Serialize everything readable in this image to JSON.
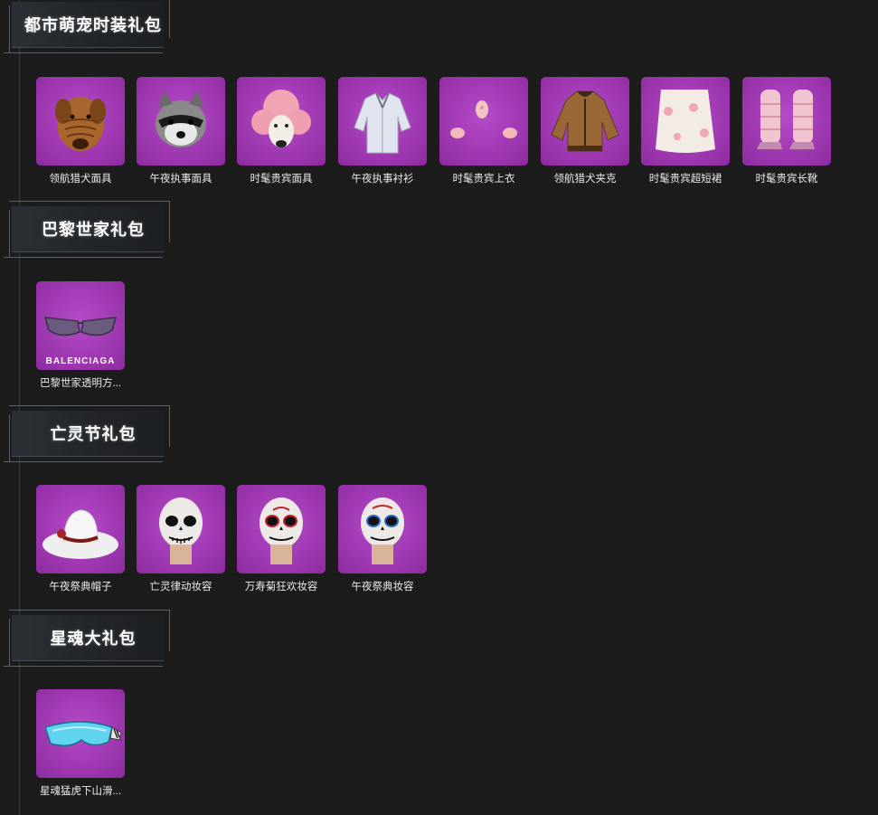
{
  "sections": [
    {
      "title": "都市萌宠时装礼包",
      "items": [
        {
          "name": "领航猎犬面具",
          "icon": "shar-pei-mask-icon"
        },
        {
          "name": "午夜执事面具",
          "icon": "raccoon-mask-icon"
        },
        {
          "name": "时髦贵宾面具",
          "icon": "poodle-mask-icon"
        },
        {
          "name": "午夜执事衬衫",
          "icon": "shirt-icon"
        },
        {
          "name": "时髦贵宾上衣",
          "icon": "pink-top-icon"
        },
        {
          "name": "领航猎犬夹克",
          "icon": "jacket-icon"
        },
        {
          "name": "时髦贵宾超短裙",
          "icon": "skirt-icon"
        },
        {
          "name": "时髦贵宾长靴",
          "icon": "boots-icon"
        }
      ]
    },
    {
      "title": "巴黎世家礼包",
      "items": [
        {
          "name": "巴黎世家透明方...",
          "icon": "sunglasses-icon",
          "brand": "BALENCIAGA"
        }
      ]
    },
    {
      "title": "亡灵节礼包",
      "items": [
        {
          "name": "午夜祭典帽子",
          "icon": "hat-icon"
        },
        {
          "name": "亡灵律动妆容",
          "icon": "skull-makeup-icon"
        },
        {
          "name": "万寿菊狂欢妆容",
          "icon": "skull-makeup-icon"
        },
        {
          "name": "午夜祭典妆容",
          "icon": "skull-makeup-icon"
        }
      ]
    },
    {
      "title": "星魂大礼包",
      "items": [
        {
          "name": "星魂猛虎下山滑...",
          "icon": "ski-goggles-icon"
        }
      ]
    }
  ],
  "colors": {
    "background": "#1c1c1d",
    "tile": "#a23cb6",
    "header_plate": "#262b30",
    "frame": "#5d6066"
  }
}
